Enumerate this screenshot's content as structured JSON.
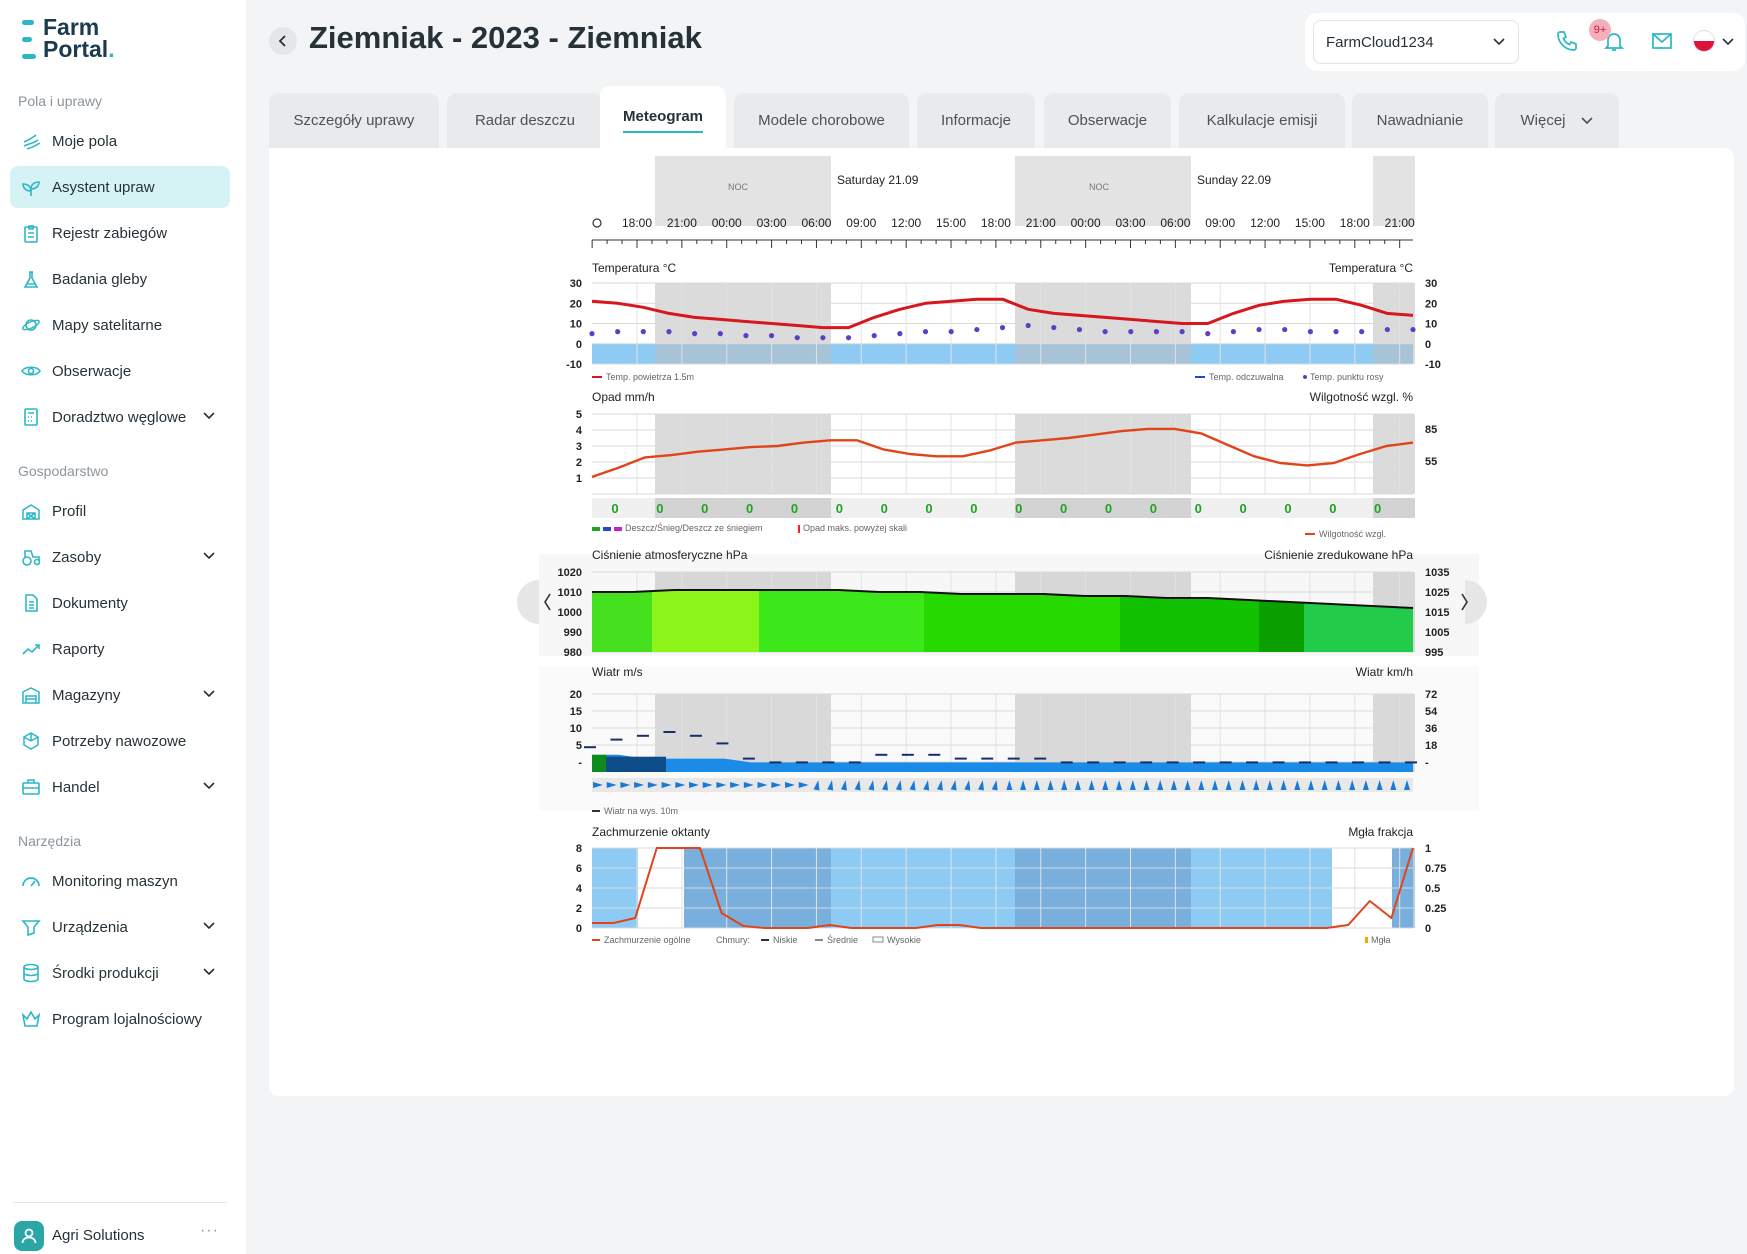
{
  "brand": {
    "line1": "Farm",
    "line2": "Portal",
    "dot": "."
  },
  "sidebar": {
    "sections": [
      {
        "title": "Pola i uprawy",
        "items": [
          {
            "label": "Moje pola",
            "icon": "fields-icon"
          },
          {
            "label": "Asystent upraw",
            "icon": "sprout-icon",
            "active": true
          },
          {
            "label": "Rejestr zabiegów",
            "icon": "clipboard-icon"
          },
          {
            "label": "Badania gleby",
            "icon": "flask-icon"
          },
          {
            "label": "Mapy satelitarne",
            "icon": "planet-icon"
          },
          {
            "label": "Obserwacje",
            "icon": "eye-icon"
          },
          {
            "label": "Doradztwo węglowe",
            "icon": "calculator-icon",
            "expandable": true
          }
        ]
      },
      {
        "title": "Gospodarstwo",
        "items": [
          {
            "label": "Profil",
            "icon": "barn-icon"
          },
          {
            "label": "Zasoby",
            "icon": "tractor-icon",
            "expandable": true
          },
          {
            "label": "Dokumenty",
            "icon": "document-icon"
          },
          {
            "label": "Raporty",
            "icon": "trend-icon"
          },
          {
            "label": "Magazyny",
            "icon": "warehouse-icon",
            "expandable": true
          },
          {
            "label": "Potrzeby nawozowe",
            "icon": "fertilizer-icon"
          },
          {
            "label": "Handel",
            "icon": "briefcase-icon",
            "expandable": true
          }
        ]
      },
      {
        "title": "Narzędzia",
        "items": [
          {
            "label": "Monitoring maszyn",
            "icon": "gauge-icon"
          },
          {
            "label": "Urządzenia",
            "icon": "device-icon",
            "expandable": true
          },
          {
            "label": "Środki produkcji",
            "icon": "database-icon",
            "expandable": true
          },
          {
            "label": "Program lojalnościowy",
            "icon": "crown-icon"
          }
        ]
      }
    ],
    "footer": {
      "company": "Agri Solutions",
      "more": "···"
    }
  },
  "header": {
    "title": "Ziemniak - 2023 - Ziemniak",
    "farm_select": "FarmCloud1234",
    "notifications_badge": "9+"
  },
  "tabs": [
    {
      "label": "Szczegóły uprawy"
    },
    {
      "label": "Radar deszczu"
    },
    {
      "label": "Meteogram",
      "active": true
    },
    {
      "label": "Modele chorobowe"
    },
    {
      "label": "Informacje"
    },
    {
      "label": "Obserwacje"
    },
    {
      "label": "Kalkulacje emisji"
    },
    {
      "label": "Nawadnianie"
    },
    {
      "label": "Więcej",
      "dropdown": true
    }
  ],
  "chart_data": {
    "type": "meteogram",
    "time_labels": [
      "18:00",
      "21:00",
      "00:00",
      "03:00",
      "06:00",
      "09:00",
      "12:00",
      "15:00",
      "18:00",
      "21:00",
      "00:00",
      "03:00",
      "06:00",
      "09:00",
      "12:00",
      "15:00",
      "18:00",
      "21:00"
    ],
    "day_labels": [
      "Saturday 21.09",
      "Sunday 22.09"
    ],
    "night_label": "NOC",
    "temperature": {
      "title_left": "Temperatura °C",
      "title_right": "Temperatura °C",
      "ticks": [
        "30",
        "20",
        "10",
        "0",
        "-10"
      ],
      "air_temp": [
        21,
        20,
        18,
        15,
        13,
        12,
        11,
        10,
        9,
        8,
        8,
        13,
        17,
        20,
        21,
        22,
        22,
        17,
        15,
        14,
        13,
        12,
        11,
        10,
        10,
        15,
        19,
        21,
        22,
        22,
        19,
        15,
        14
      ],
      "feels_like": [
        5,
        6,
        6,
        6,
        5,
        5,
        4,
        4,
        3,
        3,
        3,
        4,
        5,
        6,
        6,
        7,
        8,
        9,
        8,
        7,
        6,
        6,
        6,
        6,
        5,
        6,
        7,
        7,
        6,
        6,
        6,
        7,
        7
      ],
      "legend": [
        "Temp. powietrza 1.5m",
        "Temp. odczuwalna",
        "Temp. punktu rosy"
      ]
    },
    "precipitation": {
      "title_left": "Opad mm/h",
      "title_right": "Wilgotność wzgl. %",
      "ticks_left": [
        "5",
        "4",
        "3",
        "2",
        "1"
      ],
      "ticks_right": [
        "85",
        "55"
      ],
      "humidity": [
        40,
        48,
        57,
        59,
        62,
        64,
        66,
        67,
        70,
        72,
        72,
        64,
        60,
        58,
        58,
        63,
        70,
        72,
        74,
        77,
        80,
        82,
        82,
        78,
        68,
        58,
        52,
        50,
        52,
        60,
        67,
        70
      ],
      "values": [
        "0",
        "0",
        "0",
        "0",
        "0",
        "0",
        "0",
        "0",
        "0",
        "0",
        "0",
        "0",
        "0",
        "0",
        "0",
        "0",
        "0",
        "0"
      ],
      "legend_left": "Deszcz/Śnieg/Deszcz ze śniegiem",
      "legend_mid": "Opad maks. powyżej skali",
      "legend_right": "Wilgotność wzgl."
    },
    "pressure": {
      "title_left": "Ciśnienie atmosferyczne hPa",
      "title_right": "Ciśnienie zredukowane hPa",
      "ticks_left": [
        "1020",
        "1010",
        "1000",
        "990",
        "980"
      ],
      "ticks_right": [
        "1035",
        "1025",
        "1015",
        "1005",
        "995"
      ],
      "values": [
        1010,
        1010,
        1011,
        1011,
        1011,
        1011,
        1011,
        1010,
        1010,
        1009,
        1009,
        1009,
        1008,
        1008,
        1007,
        1007,
        1006,
        1005,
        1004,
        1003,
        1002
      ]
    },
    "wind": {
      "title_left": "Wiatr m/s",
      "title_right": "Wiatr km/h",
      "ticks_left": [
        "20",
        "15",
        "10",
        "5",
        "-"
      ],
      "ticks_right": [
        "72",
        "54",
        "36",
        "18",
        "-"
      ],
      "speed": [
        4,
        4,
        3,
        3,
        3,
        3,
        2,
        2,
        2,
        2,
        2,
        2,
        2,
        2,
        2,
        2,
        2,
        2,
        2,
        2,
        2,
        2,
        2,
        2,
        2,
        2,
        2,
        2,
        2,
        2,
        2,
        2
      ],
      "gusts": [
        6,
        8,
        9,
        10,
        9,
        7,
        3,
        2,
        2,
        2,
        2,
        4,
        4,
        4,
        3,
        3,
        3,
        3,
        2,
        2,
        2,
        2,
        2,
        2,
        2,
        2,
        2,
        2,
        2,
        2,
        2,
        2
      ],
      "legend": "Wiatr na wys. 10m"
    },
    "clouds": {
      "title_left": "Zachmurzenie oktanty",
      "title_right": "Mgła frakcja",
      "ticks_left": [
        "8",
        "6",
        "4",
        "2",
        "0"
      ],
      "ticks_right": [
        "1",
        "0.75",
        "0.5",
        "0.25",
        "0"
      ],
      "total": [
        0.5,
        0.5,
        1,
        8,
        8,
        8,
        1.5,
        0.2,
        0,
        0,
        0,
        0.3,
        0,
        0,
        0,
        0,
        0.3,
        0.3,
        0,
        0,
        0,
        0,
        0,
        0,
        0,
        0,
        0,
        0,
        0,
        0,
        0,
        0,
        0,
        0,
        0,
        0.3,
        2.7,
        1,
        8
      ],
      "legend": [
        "Zachmurzenie ogólne",
        "Chmury:",
        "Niskie",
        "Średnie",
        "Wysokie",
        "Mgła"
      ]
    }
  }
}
